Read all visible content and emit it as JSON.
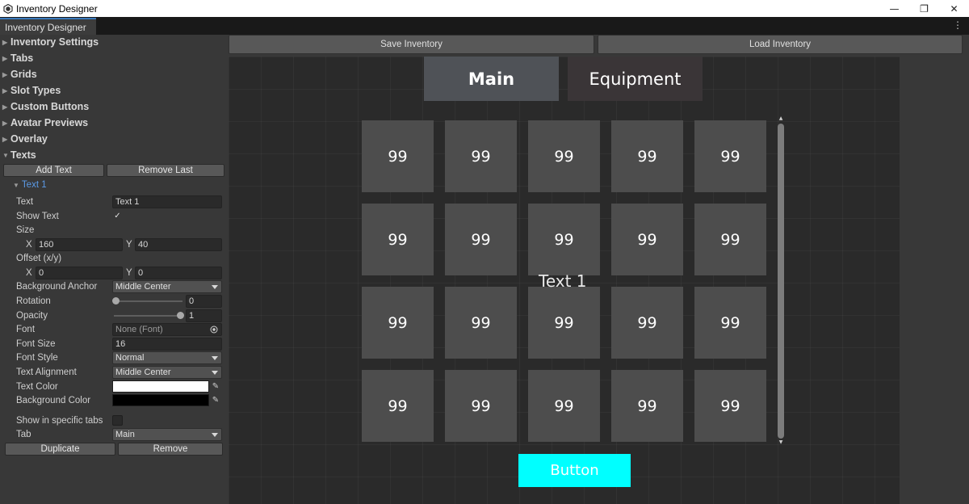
{
  "window": {
    "title": "Inventory Designer",
    "controls": {
      "minimize": "—",
      "restore": "❐",
      "close": "✕"
    }
  },
  "tabstrip": {
    "tab_label": "Inventory Designer",
    "menu_glyph": "⋮"
  },
  "sidebar": {
    "sections": [
      "Inventory Settings",
      "Tabs",
      "Grids",
      "Slot Types",
      "Custom Buttons",
      "Avatar Previews",
      "Overlay",
      "Texts"
    ],
    "add_text": "Add Text",
    "remove_last": "Remove Last",
    "text_item": {
      "title": "Text 1",
      "labels": {
        "text": "Text",
        "show_text": "Show Text",
        "size": "Size",
        "offset": "Offset (x/y)",
        "background_anchor": "Background Anchor",
        "rotation": "Rotation",
        "opacity": "Opacity",
        "font": "Font",
        "font_size": "Font Size",
        "font_style": "Font Style",
        "text_alignment": "Text Alignment",
        "text_color": "Text Color",
        "background_color": "Background Color",
        "show_in_tabs": "Show in specific tabs",
        "tab": "Tab",
        "x": "X",
        "y": "Y"
      },
      "values": {
        "text": "Text 1",
        "show_text_check": "✓",
        "size_x": "160",
        "size_y": "40",
        "offset_x": "0",
        "offset_y": "0",
        "background_anchor": "Middle Center",
        "rotation": "0",
        "rotation_level": 0.0,
        "opacity": "1",
        "opacity_level": 1.0,
        "font": "None (Font)",
        "font_size": "16",
        "font_style": "Normal",
        "text_alignment": "Middle Center",
        "text_color": "#ffffff",
        "background_color": "#000000",
        "tab": "Main"
      },
      "duplicate": "Duplicate",
      "remove": "Remove"
    }
  },
  "toolbar": {
    "save": "Save Inventory",
    "load": "Load Inventory"
  },
  "preview": {
    "tabs": [
      "Main",
      "Equipment"
    ],
    "slot_label": "99",
    "rows": 4,
    "cols": 5,
    "overlay_text": "Text 1",
    "button_label": "Button",
    "colors": {
      "button": "#00ffff",
      "slot": "#4d4d4d",
      "main_tab": "#4f5257",
      "equipment_tab": "#3a3537"
    }
  }
}
